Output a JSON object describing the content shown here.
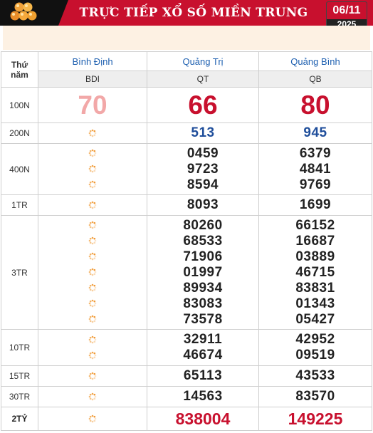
{
  "header": {
    "title": "TRỰC TIẾP XỔ SỐ MIỀN TRUNG",
    "date": "06/11",
    "year": "2025",
    "accent": "#c8102e"
  },
  "table": {
    "corner_label_1": "Thứ",
    "corner_label_2": "năm",
    "provinces": [
      {
        "name": "Bình Định",
        "code": "BDI"
      },
      {
        "name": "Quảng Trị",
        "code": "QT"
      },
      {
        "name": "Quảng Bình",
        "code": "QB"
      }
    ],
    "rows": [
      {
        "label": "100N",
        "values": [
          [
            "70"
          ],
          [
            "66"
          ],
          [
            "80"
          ]
        ]
      },
      {
        "label": "200N",
        "values": [
          [],
          [
            "513"
          ],
          [
            "945"
          ]
        ]
      },
      {
        "label": "400N",
        "values": [
          [],
          [
            "0459",
            "9723",
            "8594"
          ],
          [
            "6379",
            "4841",
            "9769"
          ]
        ]
      },
      {
        "label": "1TR",
        "values": [
          [],
          [
            "8093"
          ],
          [
            "1699"
          ]
        ]
      },
      {
        "label": "3TR",
        "values": [
          [],
          [
            "80260",
            "68533",
            "71906",
            "01997",
            "89934",
            "83083",
            "73578"
          ],
          [
            "66152",
            "16687",
            "03889",
            "46715",
            "83831",
            "01343",
            "05427"
          ]
        ]
      },
      {
        "label": "10TR",
        "values": [
          [],
          [
            "32911",
            "46674"
          ],
          [
            "42952",
            "09519"
          ]
        ]
      },
      {
        "label": "15TR",
        "values": [
          [],
          [
            "65113"
          ],
          [
            "43533"
          ]
        ]
      },
      {
        "label": "30TR",
        "values": [
          [],
          [
            "14563"
          ],
          [
            "83570"
          ]
        ]
      },
      {
        "label": "2TỶ",
        "values": [
          [],
          [
            "838004"
          ],
          [
            "149225"
          ]
        ]
      }
    ],
    "loading_icon": "spinner-icon"
  }
}
